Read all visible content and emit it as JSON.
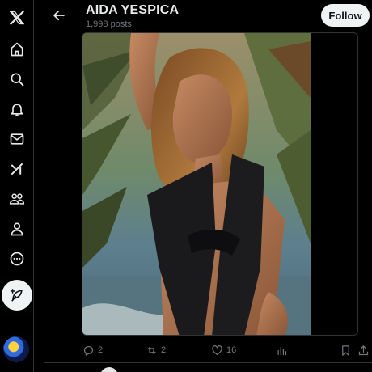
{
  "sidebar": {
    "items": [
      {
        "name": "x-logo-icon"
      },
      {
        "name": "home-icon"
      },
      {
        "name": "search-icon"
      },
      {
        "name": "notifications-icon"
      },
      {
        "name": "messages-icon"
      },
      {
        "name": "grok-icon"
      },
      {
        "name": "communities-icon"
      },
      {
        "name": "profile-icon"
      },
      {
        "name": "more-icon"
      }
    ],
    "compose_icon": "compose-feather-icon"
  },
  "header": {
    "title": "AIDA YESPICA",
    "subtitle": "1,998 posts",
    "follow_label": "Follow"
  },
  "post": {
    "media_alt": "photo",
    "actions": {
      "replies": "2",
      "reposts": "2",
      "likes": "16"
    }
  },
  "colors": {
    "background": "#000000",
    "text_primary": "#e7e9ea",
    "text_secondary": "#71767b",
    "button_bg": "#eff3f4",
    "border": "#2f3336"
  }
}
